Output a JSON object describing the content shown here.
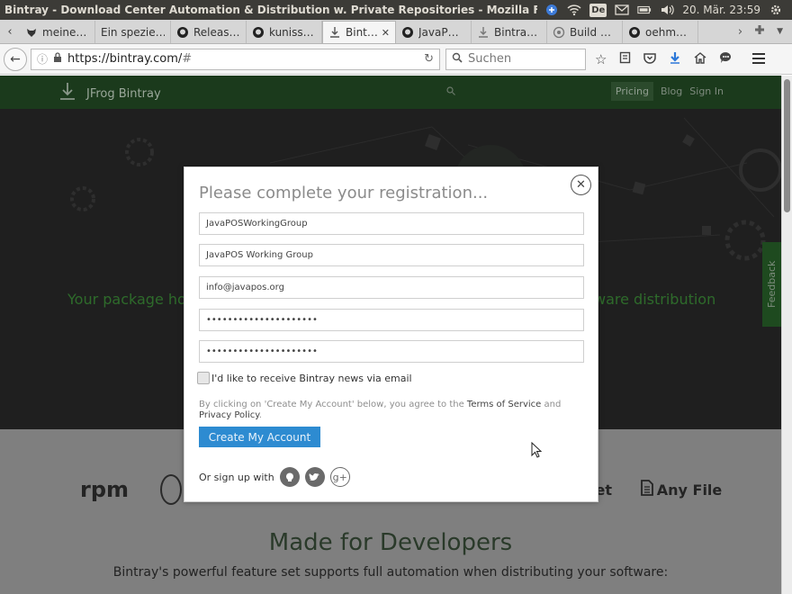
{
  "os_bar": {
    "window_title": "Bintray - Download Center Automation & Distribution w. Private Repositories - Mozilla Firefox",
    "tray": {
      "language_badge": "De",
      "clock": "20. Mär. 23:59"
    }
  },
  "tabs": [
    {
      "label": "meine…",
      "icon": "fox-icon"
    },
    {
      "label": "Ein spezie…",
      "icon": "blank-icon"
    },
    {
      "label": "Releas…",
      "icon": "github-icon"
    },
    {
      "label": "kuniss…",
      "icon": "github-icon"
    },
    {
      "label": "Bint…",
      "icon": "bintray-icon",
      "active": true
    },
    {
      "label": "JavaP…",
      "icon": "github-icon"
    },
    {
      "label": "Bintra…",
      "icon": "bintray-icon"
    },
    {
      "label": "Build …",
      "icon": "build-icon"
    },
    {
      "label": "oehm…",
      "icon": "github-icon"
    }
  ],
  "navbar": {
    "url_host": "https://bintray.com/",
    "url_path": "#",
    "search_placeholder": "Suchen"
  },
  "site": {
    "brand": "JFrog Bintray",
    "links": {
      "pricing": "Pricing",
      "blog": "Blog",
      "signin": "Sign In"
    },
    "hero_left": "Your package ho",
    "hero_right": "ware distribution",
    "feedback": "Feedback",
    "logos": {
      "rpm": "rpm",
      "net": "get",
      "any_file": "Any File"
    },
    "made_title": "Made for Developers",
    "made_sub": "Bintray's powerful feature set supports full automation when distributing your software:"
  },
  "modal": {
    "title": "Please complete your registration...",
    "fields": {
      "username": "JavaPOSWorkingGroup",
      "fullname": "JavaPOS Working Group",
      "email": "info@javapos.org",
      "password": "•••••••••••••••••••••",
      "password_confirm": "•••••••••••••••••••••"
    },
    "newsletter_label": "I'd like to receive Bintray news via email",
    "legal_prefix": "By clicking on 'Create My Account' below, you agree to the ",
    "terms_link": "Terms of Service",
    "legal_and": " and ",
    "privacy_link": "Privacy Policy",
    "legal_suffix": ".",
    "create_button": "Create My Account",
    "signup_with": "Or sign up with",
    "social": [
      "github-icon",
      "twitter-icon",
      "google-plus-icon"
    ]
  },
  "colors": {
    "primary_button": "#2d8bd1",
    "site_nav": "#1b3a1c",
    "hero_bg": "#1f1f1f"
  }
}
